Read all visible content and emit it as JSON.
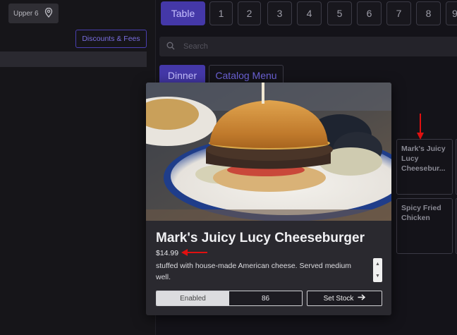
{
  "left": {
    "location_label": "Upper 6",
    "location_icon": "map-pin-icon",
    "discounts_label": "Discounts & Fees"
  },
  "tabs": [
    "Table",
    "1",
    "2",
    "3",
    "4",
    "5",
    "6",
    "7",
    "8",
    "9"
  ],
  "search": {
    "placeholder": "Search",
    "icon": "search-icon"
  },
  "categories": {
    "dinner": "Dinner",
    "catalog": "Catalog Menu"
  },
  "menu_items": [
    {
      "label": "Mark's Juicy Lucy Cheesebur..."
    },
    {
      "label": "Spicy Fried Chicken"
    }
  ],
  "modal": {
    "title": "Mark's Juicy Lucy Cheeseburger",
    "price": "$14.99",
    "description": "stuffed with house-made American cheese. Served medium well.",
    "enabled_label": "Enabled",
    "eighty_six_label": "86",
    "set_stock_label": "Set Stock"
  },
  "colors": {
    "accent": "#4438a8",
    "annotation_arrow": "#e01010"
  }
}
